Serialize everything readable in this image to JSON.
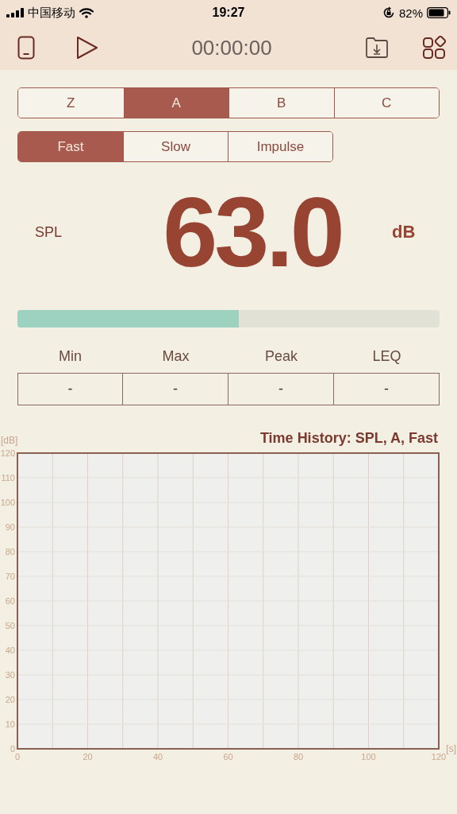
{
  "status_bar": {
    "carrier": "中国移动",
    "time": "19:27",
    "battery": "82%"
  },
  "toolbar": {
    "timer": "00:00:00"
  },
  "weightings": [
    {
      "label": "Z",
      "selected": false
    },
    {
      "label": "A",
      "selected": true
    },
    {
      "label": "B",
      "selected": false
    },
    {
      "label": "C",
      "selected": false
    }
  ],
  "responses": [
    {
      "label": "Fast",
      "selected": true
    },
    {
      "label": "Slow",
      "selected": false
    },
    {
      "label": "Impulse",
      "selected": false
    }
  ],
  "reading": {
    "label": "SPL",
    "value": "63.0",
    "unit": "dB"
  },
  "meter": {
    "level": 0.525
  },
  "stats": [
    {
      "label": "Min",
      "value": "-"
    },
    {
      "label": "Max",
      "value": "-"
    },
    {
      "label": "Peak",
      "value": "-"
    },
    {
      "label": "LEQ",
      "value": "-"
    }
  ],
  "history": {
    "chart_data": {
      "type": "line",
      "title": "Time History: SPL, A, Fast",
      "ylabel": "[dB]",
      "xlabel": "[s]",
      "grid": true,
      "xlim": [
        0,
        120
      ],
      "ylim": [
        0,
        120
      ],
      "xticks": [
        0,
        20,
        40,
        60,
        80,
        100,
        120
      ],
      "yticks": [
        0,
        10,
        20,
        30,
        40,
        50,
        60,
        70,
        80,
        90,
        100,
        110,
        120
      ]
    }
  }
}
